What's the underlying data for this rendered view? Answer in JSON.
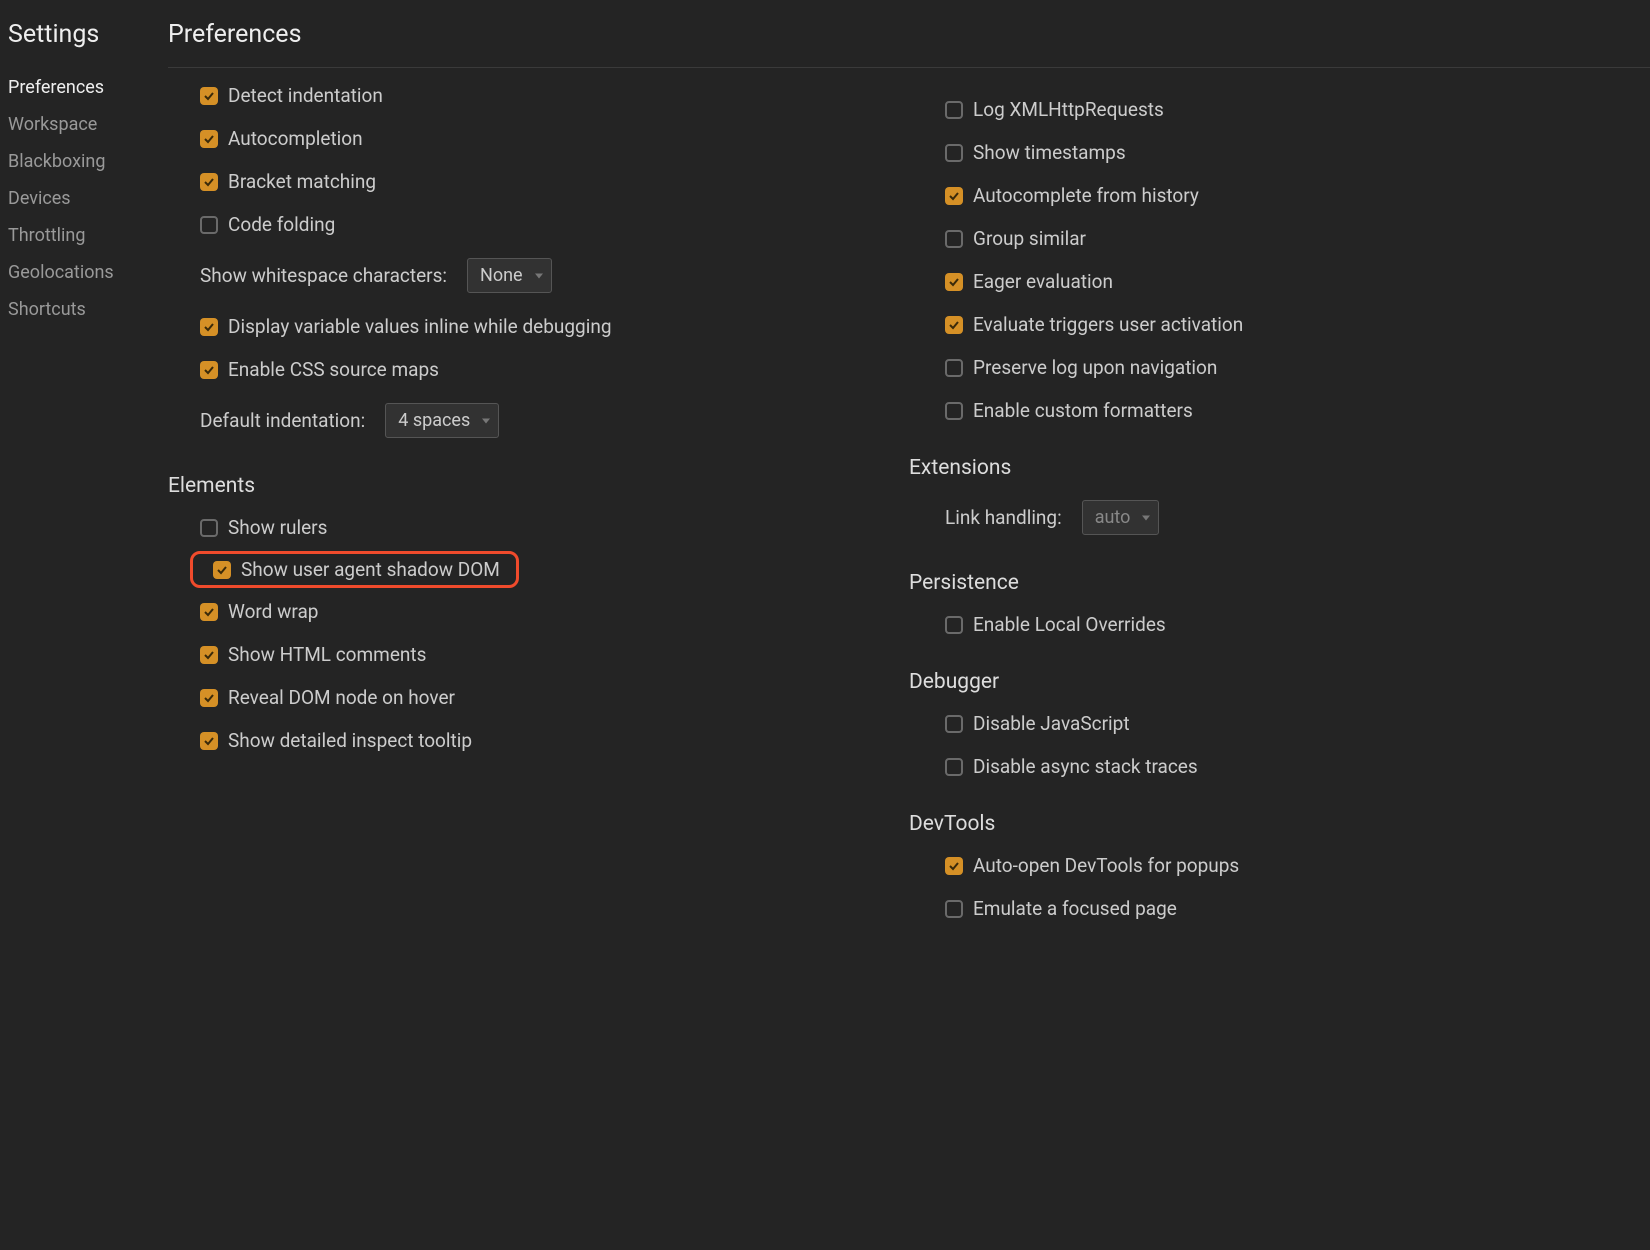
{
  "sidebar": {
    "title": "Settings",
    "items": [
      {
        "label": "Preferences",
        "active": true
      },
      {
        "label": "Workspace",
        "active": false
      },
      {
        "label": "Blackboxing",
        "active": false
      },
      {
        "label": "Devices",
        "active": false
      },
      {
        "label": "Throttling",
        "active": false
      },
      {
        "label": "Geolocations",
        "active": false
      },
      {
        "label": "Shortcuts",
        "active": false
      }
    ]
  },
  "main": {
    "title": "Preferences"
  },
  "left_col": {
    "sources": {
      "detect_indentation": {
        "label": "Detect indentation",
        "checked": true
      },
      "autocompletion": {
        "label": "Autocompletion",
        "checked": true
      },
      "bracket_matching": {
        "label": "Bracket matching",
        "checked": true
      },
      "code_folding": {
        "label": "Code folding",
        "checked": false
      },
      "show_whitespace": {
        "label": "Show whitespace characters:",
        "value": "None"
      },
      "display_inline": {
        "label": "Display variable values inline while debugging",
        "checked": true
      },
      "css_source_maps": {
        "label": "Enable CSS source maps",
        "checked": true
      },
      "default_indentation": {
        "label": "Default indentation:",
        "value": "4 spaces"
      }
    },
    "elements_heading": "Elements",
    "elements": {
      "show_rulers": {
        "label": "Show rulers",
        "checked": false
      },
      "shadow_dom": {
        "label": "Show user agent shadow DOM",
        "checked": true
      },
      "word_wrap": {
        "label": "Word wrap",
        "checked": true
      },
      "html_comments": {
        "label": "Show HTML comments",
        "checked": true
      },
      "reveal_hover": {
        "label": "Reveal DOM node on hover",
        "checked": true
      },
      "detailed_tooltip": {
        "label": "Show detailed inspect tooltip",
        "checked": true
      }
    }
  },
  "right_col": {
    "console": {
      "log_xhr": {
        "label": "Log XMLHttpRequests",
        "checked": false
      },
      "show_timestamps": {
        "label": "Show timestamps",
        "checked": false
      },
      "autocomplete_history": {
        "label": "Autocomplete from history",
        "checked": true
      },
      "group_similar": {
        "label": "Group similar",
        "checked": false
      },
      "eager_eval": {
        "label": "Eager evaluation",
        "checked": true
      },
      "eval_triggers": {
        "label": "Evaluate triggers user activation",
        "checked": true
      },
      "preserve_log": {
        "label": "Preserve log upon navigation",
        "checked": false
      },
      "custom_formatters": {
        "label": "Enable custom formatters",
        "checked": false
      }
    },
    "extensions_heading": "Extensions",
    "extensions": {
      "link_handling": {
        "label": "Link handling:",
        "value": "auto"
      }
    },
    "persistence_heading": "Persistence",
    "persistence": {
      "local_overrides": {
        "label": "Enable Local Overrides",
        "checked": false
      }
    },
    "debugger_heading": "Debugger",
    "debugger": {
      "disable_js": {
        "label": "Disable JavaScript",
        "checked": false
      },
      "disable_async": {
        "label": "Disable async stack traces",
        "checked": false
      }
    },
    "devtools_heading": "DevTools",
    "devtools": {
      "auto_open": {
        "label": "Auto-open DevTools for popups",
        "checked": true
      },
      "emulate_focus": {
        "label": "Emulate a focused page",
        "checked": false
      }
    }
  }
}
